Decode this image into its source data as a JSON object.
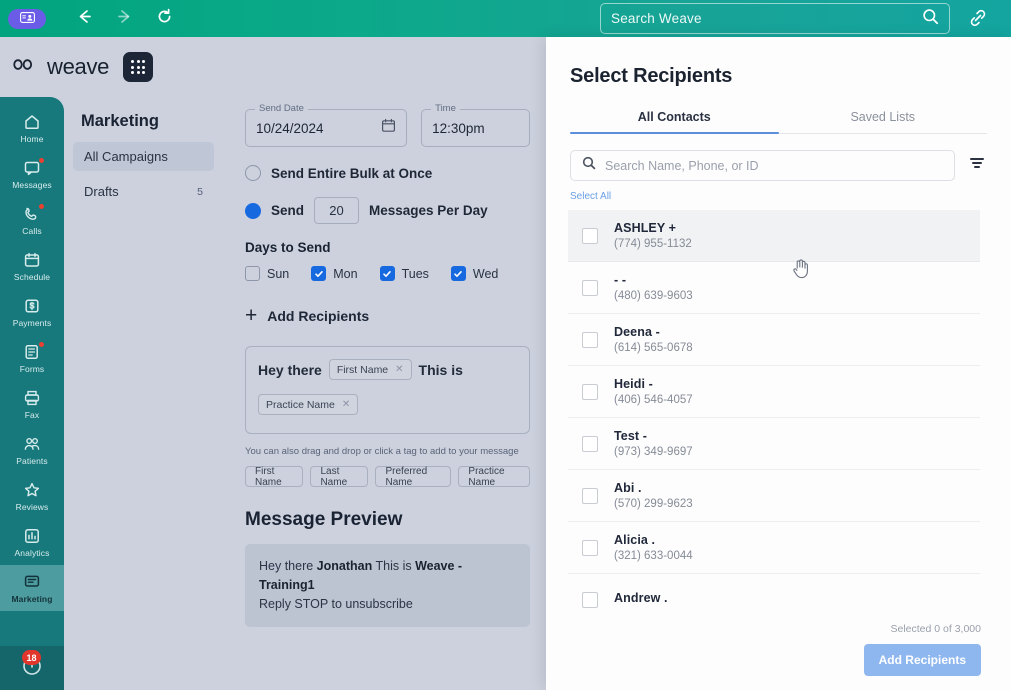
{
  "browser": {
    "extension_icon": "contact-card-icon",
    "back_icon": "arrow-left-icon",
    "forward_icon": "arrow-right-icon",
    "reload_icon": "reload-icon",
    "search_placeholder": "Search Weave",
    "search_icon": "search-icon",
    "link_icon": "link-icon",
    "accent": "#0ca98a"
  },
  "brand": {
    "wordmark": "weave",
    "logo_icon": "weave-infinity-logo-icon",
    "dialpad_icon": "dialpad-icon"
  },
  "rail": {
    "active_color": "#4d9ca0",
    "bg_color": "#18797d",
    "items": [
      {
        "label": "Home",
        "icon": "home-icon",
        "badge": false,
        "active": false
      },
      {
        "label": "Messages",
        "icon": "messages-icon",
        "badge": true,
        "active": false
      },
      {
        "label": "Calls",
        "icon": "phone-icon",
        "badge": true,
        "active": false
      },
      {
        "label": "Schedule",
        "icon": "calendar-icon",
        "badge": false,
        "active": false
      },
      {
        "label": "Payments",
        "icon": "payments-icon",
        "badge": false,
        "active": false
      },
      {
        "label": "Forms",
        "icon": "forms-icon",
        "badge": true,
        "active": false
      },
      {
        "label": "Fax",
        "icon": "fax-icon",
        "badge": false,
        "active": false
      },
      {
        "label": "Patients",
        "icon": "patients-icon",
        "badge": false,
        "active": false
      },
      {
        "label": "Reviews",
        "icon": "star-icon",
        "badge": false,
        "active": false
      },
      {
        "label": "Analytics",
        "icon": "analytics-icon",
        "badge": false,
        "active": false
      },
      {
        "label": "Marketing",
        "icon": "marketing-icon",
        "badge": false,
        "active": true
      }
    ],
    "bottom_badge_count": "18",
    "bottom_icon": "notifications-icon"
  },
  "subnav": {
    "title": "Marketing",
    "items": [
      {
        "label": "All Campaigns",
        "count": "",
        "selected": true
      },
      {
        "label": "Drafts",
        "count": "5",
        "selected": false
      }
    ]
  },
  "campaign": {
    "send_date": {
      "label": "Send Date",
      "value": "10/24/2024",
      "icon": "calendar-icon"
    },
    "time": {
      "label": "Time",
      "value": "12:30pm"
    },
    "bulk_option": {
      "label": "Send Entire Bulk at Once",
      "selected": false
    },
    "throttle_option": {
      "prefix_label": "Send",
      "value": "20",
      "suffix_label": "Messages Per Day",
      "selected": true
    },
    "days_title": "Days to Send",
    "days": [
      {
        "label": "Sun",
        "checked": false
      },
      {
        "label": "Mon",
        "checked": true
      },
      {
        "label": "Tues",
        "checked": true
      },
      {
        "label": "Wed",
        "checked": true
      }
    ],
    "add_recipients_label": "Add Recipients",
    "add_recipients_icon": "plus-icon",
    "composer": {
      "text1": "Hey there",
      "chip1": "First Name",
      "text2": "This is",
      "chip2": "Practice Name",
      "remove_icon": "close-icon"
    },
    "hint": "You can also drag and drop or click a tag to add to your message",
    "tags": [
      "First Name",
      "Last Name",
      "Preferred Name",
      "Practice Name"
    ],
    "preview_title": "Message Preview",
    "preview": {
      "line1_a": "Hey there ",
      "line1_name": "Jonathan",
      "line1_b": " This is ",
      "line1_practice": "Weave - Training1",
      "line2": "Reply STOP to unsubscribe"
    }
  },
  "drawer": {
    "title": "Select Recipients",
    "tabs": [
      {
        "label": "All Contacts",
        "active": true
      },
      {
        "label": "Saved Lists",
        "active": false
      }
    ],
    "search_placeholder": "Search Name, Phone, or ID",
    "search_icon": "search-icon",
    "filter_icon": "filter-icon",
    "select_all_label": "Select All",
    "accent": "#5b8fdc",
    "contacts": [
      {
        "name": "ASHLEY +",
        "phone": "(774) 955-1132",
        "checked": false,
        "highlighted": true
      },
      {
        "name": "- -",
        "phone": "(480) 639-9603",
        "checked": false,
        "highlighted": false
      },
      {
        "name": "Deena -",
        "phone": "(614) 565-0678",
        "checked": false,
        "highlighted": false
      },
      {
        "name": "Heidi -",
        "phone": "(406) 546-4057",
        "checked": false,
        "highlighted": false
      },
      {
        "name": "Test -",
        "phone": "(973) 349-9697",
        "checked": false,
        "highlighted": false
      },
      {
        "name": "Abi .",
        "phone": "(570) 299-9623",
        "checked": false,
        "highlighted": false
      },
      {
        "name": "Alicia .",
        "phone": "(321) 633-0044",
        "checked": false,
        "highlighted": false
      },
      {
        "name": "Andrew .",
        "phone": "",
        "checked": false,
        "highlighted": false
      }
    ],
    "selected_count_label": "Selected 0 of 3,000",
    "add_button_label": "Add Recipients"
  }
}
